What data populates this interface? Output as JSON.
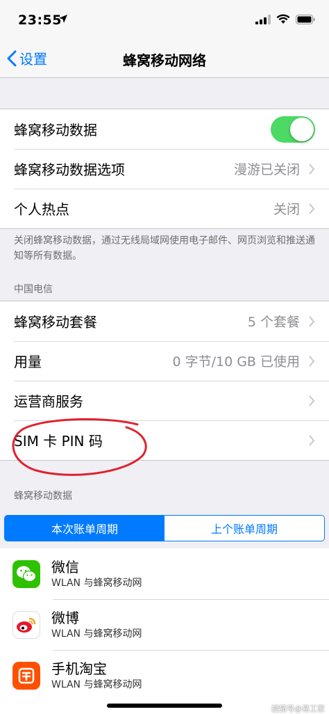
{
  "status_bar": {
    "time": "23:55"
  },
  "nav": {
    "back_label": "设置",
    "title": "蜂窝移动网络"
  },
  "group1": {
    "rows": [
      {
        "label": "蜂窝移动数据",
        "toggle_on": true
      },
      {
        "label": "蜂窝移动数据选项",
        "value": "漫游已关闭"
      },
      {
        "label": "个人热点",
        "value": "关闭"
      }
    ]
  },
  "footnote1": "关闭蜂窝移动数据，通过无线局域网使用电子邮件、网页浏览和推送通知等所有数据。",
  "carrier_header": "中国电信",
  "group2": {
    "rows": [
      {
        "label": "蜂窝移动套餐",
        "value": "5 个套餐"
      },
      {
        "label": "用量",
        "value": "0 字节/10 GB 已使用"
      },
      {
        "label": "运营商服务",
        "value": ""
      },
      {
        "label": "SIM 卡 PIN 码",
        "value": ""
      }
    ]
  },
  "data_header": "蜂窝移动数据",
  "segment": {
    "options": [
      "本次账单周期",
      "上个账单周期"
    ],
    "selected": 0
  },
  "apps": [
    {
      "name": "微信",
      "sub": "WLAN 与蜂窝移动网",
      "icon": "wechat-icon"
    },
    {
      "name": "微博",
      "sub": "WLAN 与蜂窝移动网",
      "icon": "weibo-icon"
    },
    {
      "name": "手机淘宝",
      "sub": "WLAN 与蜂窝移动网",
      "icon": "taobao-icon"
    }
  ],
  "watermark": "搜狐号@易工家",
  "colors": {
    "accent": "#007aff",
    "toggle_on": "#4cd964",
    "annotation": "#e0212e"
  }
}
